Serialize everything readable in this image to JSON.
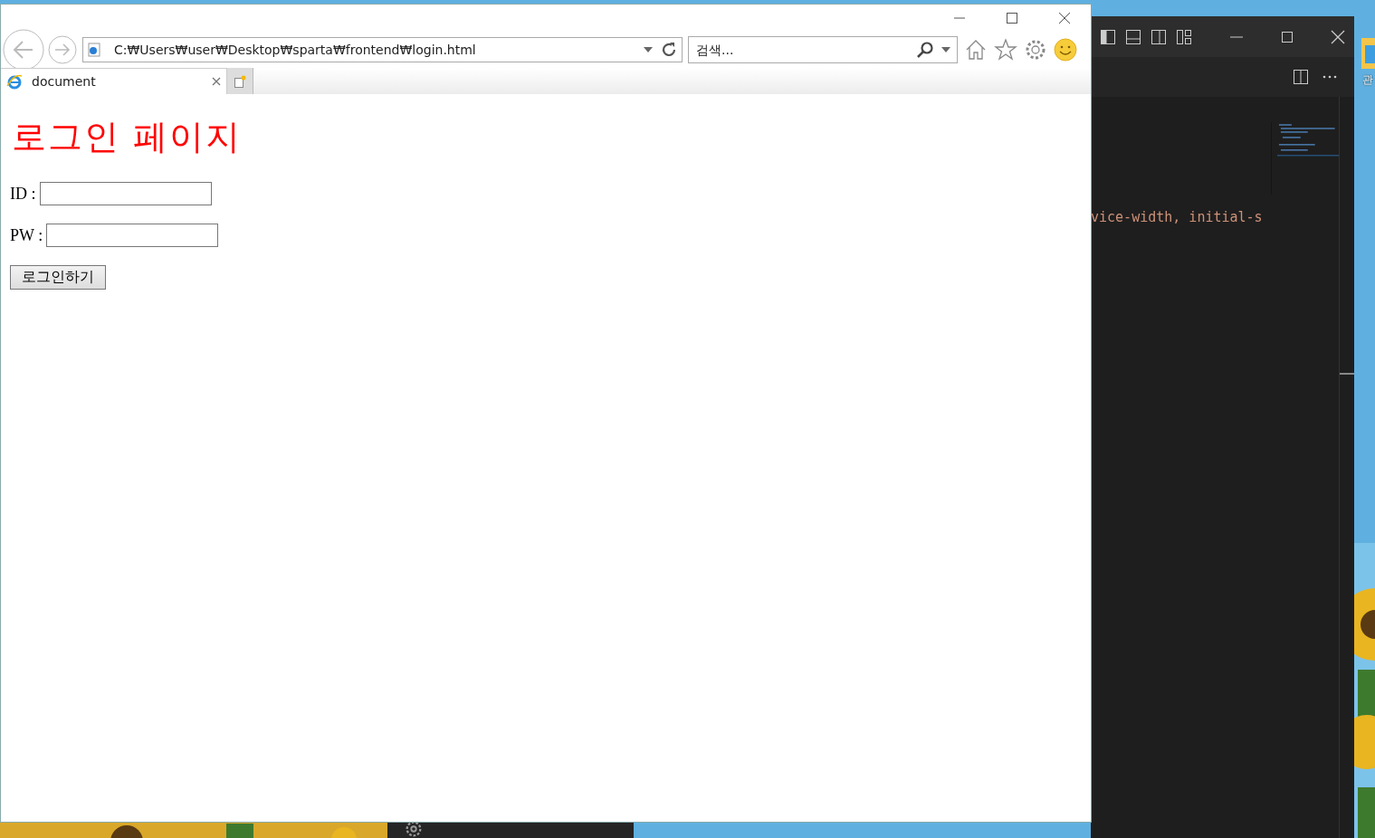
{
  "browser": {
    "address": "C:₩Users₩user₩Desktop₩sparta₩frontend₩login.html",
    "search": {
      "placeholder": "검색..."
    },
    "tabs": [
      {
        "title": "document",
        "selected": true
      }
    ],
    "page": {
      "heading": "로그인 페이지",
      "fields": [
        {
          "label": "ID :"
        },
        {
          "label": "PW :"
        }
      ],
      "submit": "로그인하기"
    }
  },
  "editor": {
    "code_line": "vice-width, initial-s"
  },
  "desktop": {
    "icon_label": "관"
  }
}
